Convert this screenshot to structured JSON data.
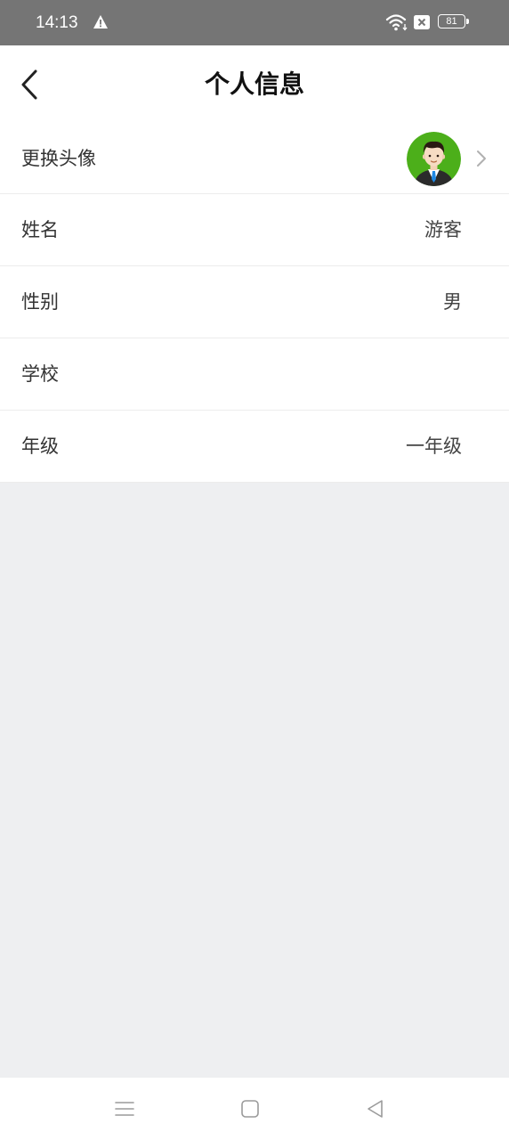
{
  "status_bar": {
    "time": "14:13",
    "battery_level": "81",
    "icons": [
      "warning-icon",
      "wifi-icon",
      "sim-icon",
      "battery-icon"
    ]
  },
  "header": {
    "title": "个人信息",
    "back_icon": "chevron-left-icon"
  },
  "rows": [
    {
      "label": "更换头像",
      "value": "",
      "icon": "avatar",
      "chevron": true
    },
    {
      "label": "姓名",
      "value": "游客"
    },
    {
      "label": "性别",
      "value": "男"
    },
    {
      "label": "学校",
      "value": ""
    },
    {
      "label": "年级",
      "value": "一年级"
    }
  ],
  "nav_bar": {
    "icons": [
      "menu-icon",
      "home-icon",
      "back-triangle-icon"
    ]
  },
  "colors": {
    "status_bar": "#757575",
    "background": "#eeeff1",
    "avatar_green": "#4caf1a"
  }
}
